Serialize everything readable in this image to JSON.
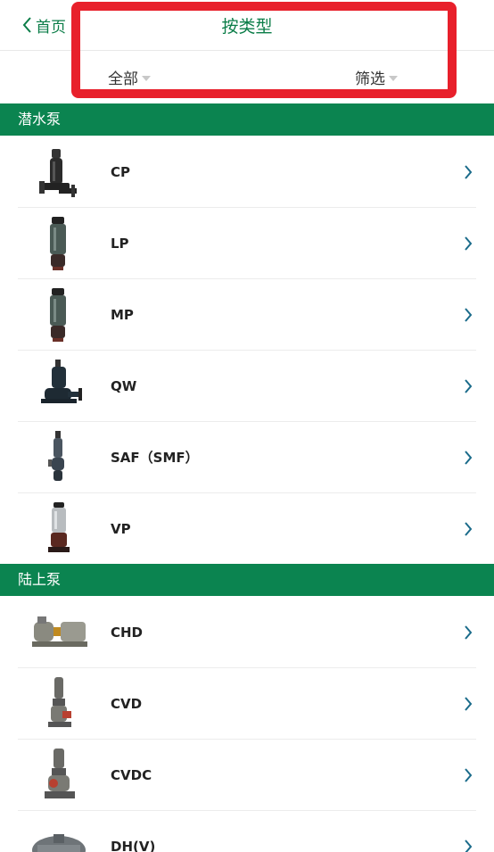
{
  "header": {
    "back_label": "首页",
    "title": "按类型",
    "dropdowns": {
      "all": "全部",
      "filter": "筛选"
    }
  },
  "sections": [
    {
      "title": "潜水泵",
      "items": [
        {
          "label": "CP",
          "thumb": "submersible-pump-cp-icon"
        },
        {
          "label": "LP",
          "thumb": "submersible-pump-lp-icon"
        },
        {
          "label": "MP",
          "thumb": "submersible-pump-mp-icon"
        },
        {
          "label": "QW",
          "thumb": "submersible-pump-qw-icon"
        },
        {
          "label": "SAF（SMF）",
          "thumb": "submersible-pump-saf-icon"
        },
        {
          "label": "VP",
          "thumb": "submersible-pump-vp-icon"
        }
      ]
    },
    {
      "title": "陆上泵",
      "items": [
        {
          "label": "CHD",
          "thumb": "land-pump-chd-icon"
        },
        {
          "label": "CVD",
          "thumb": "land-pump-cvd-icon"
        },
        {
          "label": "CVDC",
          "thumb": "land-pump-cvdc-icon"
        },
        {
          "label": "DH(V)",
          "thumb": "land-pump-dhv-icon"
        }
      ]
    }
  ],
  "colors": {
    "accent": "#0b7d48",
    "section_bg": "#0b8450",
    "highlight": "#e8202b"
  }
}
